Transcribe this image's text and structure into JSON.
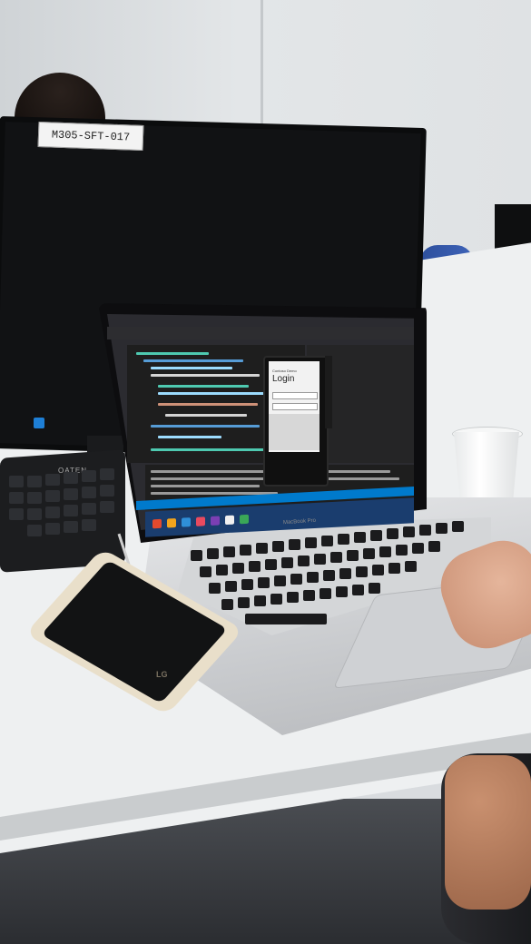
{
  "scene": {
    "monitor_label": "M305-SFT-017",
    "external_keyboard_brand": "OATEN",
    "laptop_brand": "MacBook Pro",
    "phone_brand": "LG",
    "emulator": {
      "small_title": "Contoso Demo",
      "heading": "Login"
    }
  },
  "colors": {
    "vs_dark": "#1e1e1e",
    "vs_accent": "#007acc",
    "taskbar": "#1a3d6e",
    "chair": "#3e63b8"
  }
}
